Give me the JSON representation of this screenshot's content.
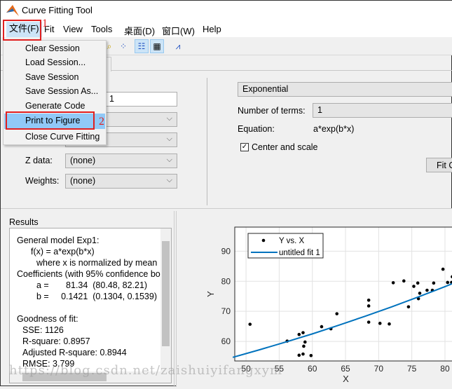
{
  "window": {
    "title": "Curve Fitting Tool",
    "icon": "matlab-logo-icon"
  },
  "menubar": {
    "items": [
      "文件(F)",
      "Fit",
      "View",
      "Tools",
      "桌面(D)",
      "窗口(W)",
      "Help"
    ]
  },
  "file_menu": {
    "items": [
      "Clear Session",
      "Load Session...",
      "Save Session",
      "Save Session As...",
      "Generate Code",
      "Print to Figure",
      "Close Curve Fitting"
    ],
    "highlighted": "Print to Figure"
  },
  "annotations": {
    "step1": "1",
    "step2": "2",
    "color": "#e02020"
  },
  "data_panel": {
    "fit_name_value": "1",
    "z_label": "Z data:",
    "z_value": "(none)",
    "weights_label": "Weights:",
    "weights_value": "(none)"
  },
  "fit_panel": {
    "type_value": "Exponential",
    "terms_label": "Number of terms:",
    "terms_value": "1",
    "equation_label": "Equation:",
    "equation_value": "a*exp(b*x)",
    "center_scale_label": "Center and scale",
    "center_scale_checked": true,
    "fit_button": "Fit C"
  },
  "results": {
    "title": "Results",
    "lines": [
      "General model Exp1:",
      "f(x) = a*exp(b*x)",
      "where x is normalized by mean",
      "Coefficients (with 95% confidence bo",
      "a =       81.34  (80.48, 82.21)",
      "b =     0.1421  (0.1304, 0.1539)",
      "",
      "Goodness of fit:",
      "SSE: 1126",
      "R-square: 0.8957",
      "Adjusted R-square: 0.8944",
      "RMSE: 3.799"
    ]
  },
  "watermark": "https://blog.csdn.net/zaishuiyifangxym",
  "chart_data": {
    "type": "scatter",
    "xlabel": "X",
    "ylabel": "Y",
    "xlim": [
      48.3,
      81.8
    ],
    "ylim": [
      53.5,
      98
    ],
    "xticks": [
      50,
      55,
      60,
      65,
      70,
      75,
      80
    ],
    "yticks": [
      60,
      70,
      80,
      90
    ],
    "grid": true,
    "legend_placement": "top-left",
    "legend": [
      "Y vs. X",
      "untitled fit 1"
    ],
    "fit_color": "#0072bd",
    "points": {
      "x": [
        50.6,
        56.2,
        58.0,
        58.6,
        58.7,
        58.9,
        58.0,
        58.6,
        59.8,
        61.4,
        62.8,
        63.7,
        68.5,
        68.5,
        68.5,
        70.2,
        71.6,
        72.2,
        73.8,
        74.5,
        75.3,
        75.9,
        76.0,
        76.2,
        77.3,
        78.1,
        78.3,
        79.7,
        80.4,
        81.0,
        81.1,
        81.3
      ],
      "y": [
        65.7,
        60.1,
        62.3,
        62.9,
        58.4,
        59.8,
        55.4,
        55.8,
        55.3,
        64.9,
        64.2,
        69.2,
        73.7,
        71.8,
        66.4,
        66.0,
        65.8,
        79.5,
        80.1,
        71.5,
        78.3,
        79.4,
        74.2,
        76.0,
        77.0,
        77.0,
        79.4,
        84.0,
        79.6,
        79.6,
        81.5,
        83.6
      ]
    },
    "fit": {
      "x": [
        48,
        52,
        56,
        60,
        64,
        68,
        72,
        76,
        80,
        82
      ],
      "y": [
        54.7,
        57.2,
        59.8,
        62.5,
        65.4,
        68.4,
        71.5,
        74.8,
        78.2,
        80.0
      ]
    }
  }
}
